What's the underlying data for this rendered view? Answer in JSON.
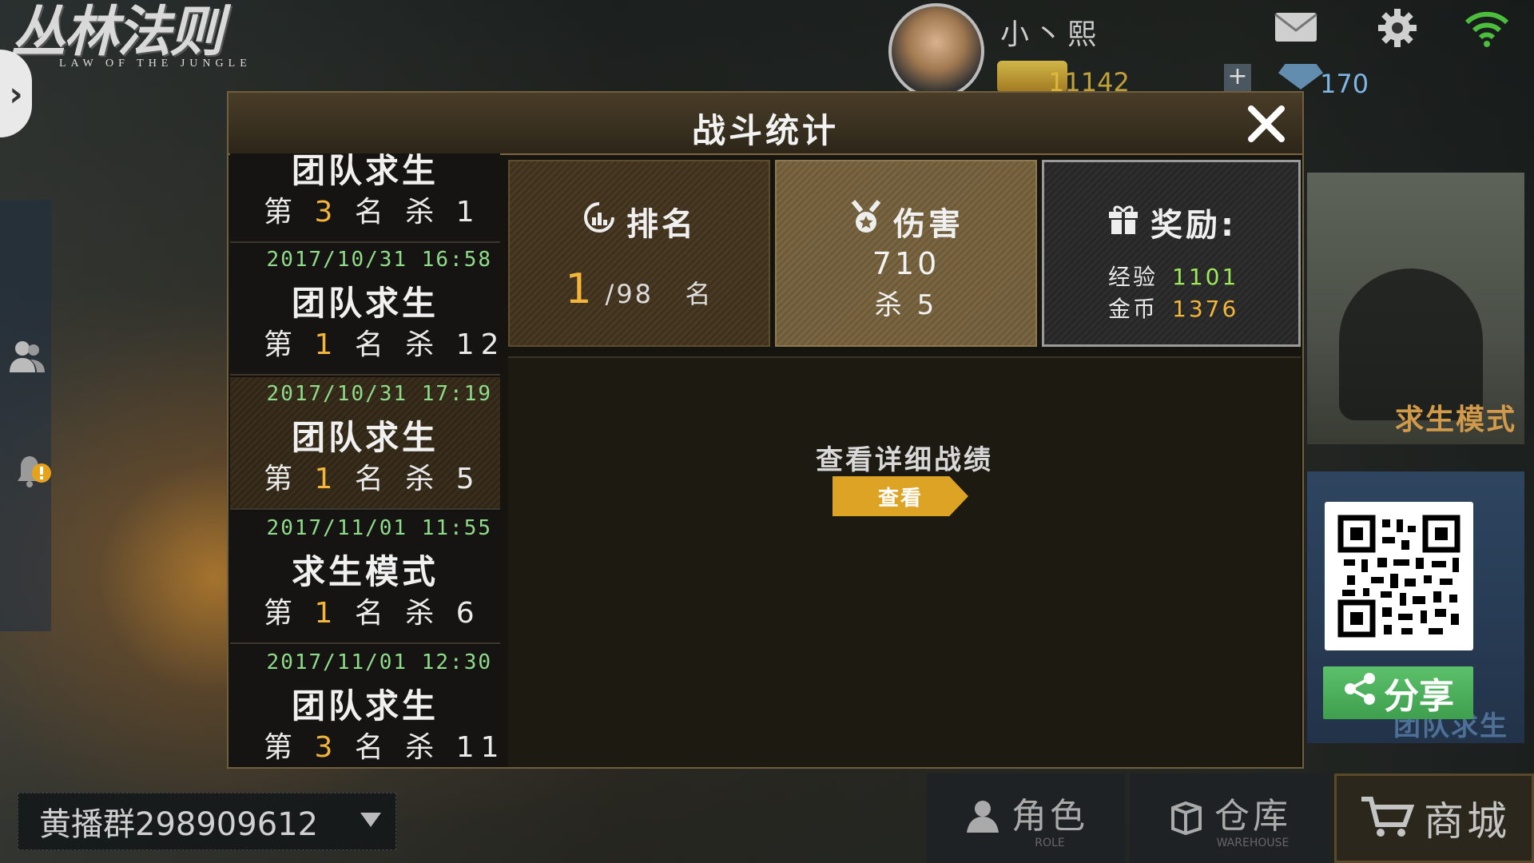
{
  "logo": {
    "main": "丛林法则",
    "sub": "LAW OF THE JUNGLE"
  },
  "player": {
    "name": "小丶熙",
    "gold": "11142",
    "gems": "170"
  },
  "right_panel": {
    "mode_card_label": "求生模式",
    "team_card_label": "团队求生",
    "share_label": "分享"
  },
  "bottom": {
    "group_text": "黄播群298909612",
    "role": {
      "cn": "角色",
      "en": "ROLE"
    },
    "warehouse": {
      "cn": "仓库",
      "en": "WAREHOUSE"
    },
    "shop": {
      "cn": "商城"
    }
  },
  "dialog": {
    "title": "战斗统计",
    "history": [
      {
        "date": "",
        "mode": "团队求生",
        "prefix": "第",
        "rank": "3",
        "suffix": "名 杀",
        "kills": "1"
      },
      {
        "date": "2017/10/31 16:58",
        "mode": "团队求生",
        "prefix": "第",
        "rank": "1",
        "suffix": "名 杀",
        "kills": "12"
      },
      {
        "date": "2017/10/31 17:19",
        "mode": "团队求生",
        "prefix": "第",
        "rank": "1",
        "suffix": "名 杀",
        "kills": "5"
      },
      {
        "date": "2017/11/01 11:55",
        "mode": "求生模式",
        "prefix": "第",
        "rank": "1",
        "suffix": "名 杀",
        "kills": "6"
      },
      {
        "date": "2017/11/01 12:30",
        "mode": "团队求生",
        "prefix": "第",
        "rank": "3",
        "suffix": "名 杀",
        "kills": "11"
      }
    ],
    "rank_card": {
      "title": "排名",
      "rank": "1",
      "total": "/98",
      "unit": "名"
    },
    "damage_card": {
      "title": "伤害",
      "damage": "710",
      "kills": "杀 5"
    },
    "reward_card": {
      "title": "奖励:",
      "exp_label": "经验",
      "exp": "1101",
      "gold_label": "金币",
      "gold": "1376"
    },
    "detail_text": "查看详细战绩",
    "view_button": "查看"
  }
}
